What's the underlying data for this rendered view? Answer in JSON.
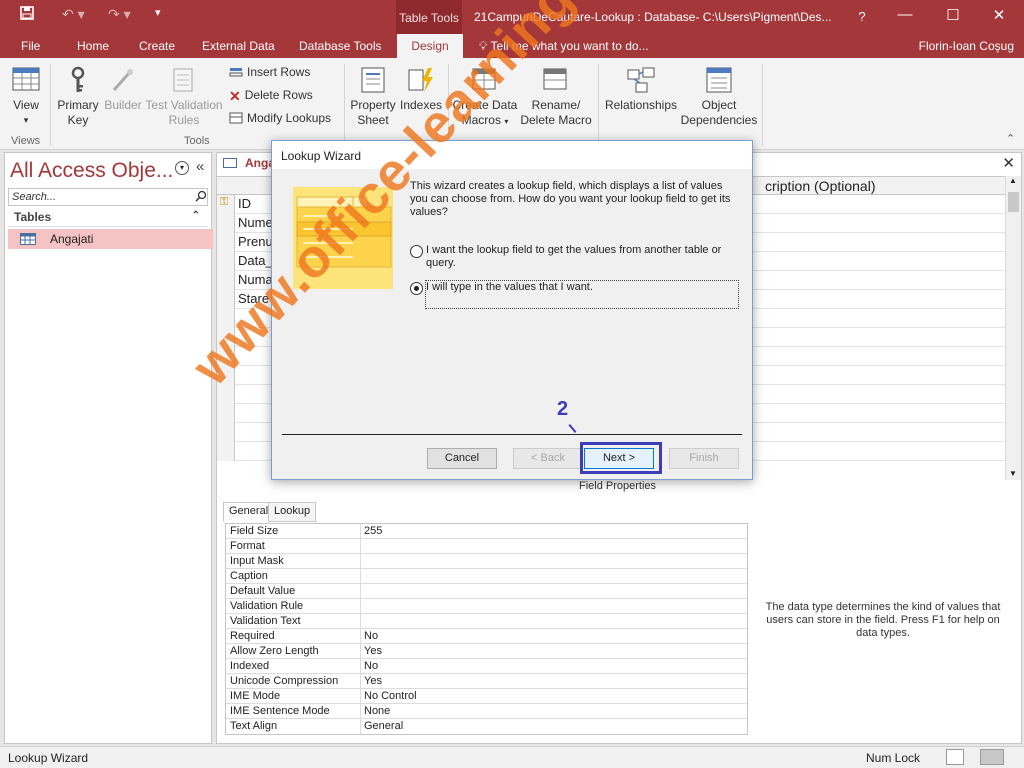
{
  "window": {
    "context_tab": "Table Tools",
    "title": "21CampuriDeCautare-Lookup : Database- C:\\Users\\Pigment\\Des...",
    "help_glyph": "?",
    "min_glyph": "—",
    "max_glyph": "☐",
    "close_glyph": "✕"
  },
  "tabs": [
    "File",
    "Home",
    "Create",
    "External Data",
    "Database Tools",
    "Design"
  ],
  "tell_me": "Tell me what you want to do...",
  "user": "Florin-Ioan Coşug",
  "ribbon": {
    "view": "View",
    "views_group": "Views",
    "primary_key": [
      "Primary",
      "Key"
    ],
    "builder": "Builder",
    "test_validation": [
      "Test Validation",
      "Rules"
    ],
    "insert_rows": "Insert Rows",
    "delete_rows": "Delete Rows",
    "modify_lookups": "Modify Lookups",
    "tools_group": "Tools",
    "property_sheet": [
      "Property",
      "Sheet"
    ],
    "indexes": "Indexes",
    "create_data_macros": [
      "Create Data",
      "Macros"
    ],
    "rename_delete_macro": [
      "Rename/",
      "Delete Macro"
    ],
    "relationships": "Relationships",
    "object_dependencies": [
      "Object",
      "Dependencies"
    ]
  },
  "nav": {
    "title": "All Access Obje...",
    "search_placeholder": "Search...",
    "section": "Tables",
    "item": "Angajati"
  },
  "doc": {
    "tab": "Angaj",
    "description_header": "cription (Optional)",
    "fields": [
      "ID",
      "Nume",
      "Prenu",
      "Data_",
      "Numa",
      "Stare"
    ],
    "field_properties_label": "Field Properties",
    "fp_tabs": [
      "General",
      "Lookup"
    ],
    "fp_rows": [
      {
        "k": "Field Size",
        "v": "255"
      },
      {
        "k": "Format",
        "v": ""
      },
      {
        "k": "Input Mask",
        "v": ""
      },
      {
        "k": "Caption",
        "v": ""
      },
      {
        "k": "Default Value",
        "v": ""
      },
      {
        "k": "Validation Rule",
        "v": ""
      },
      {
        "k": "Validation Text",
        "v": ""
      },
      {
        "k": "Required",
        "v": "No"
      },
      {
        "k": "Allow Zero Length",
        "v": "Yes"
      },
      {
        "k": "Indexed",
        "v": "No"
      },
      {
        "k": "Unicode Compression",
        "v": "Yes"
      },
      {
        "k": "IME Mode",
        "v": "No Control"
      },
      {
        "k": "IME Sentence Mode",
        "v": "None"
      },
      {
        "k": "Text Align",
        "v": "General"
      }
    ],
    "help_text": "The data type determines the kind of values that users can store in the field. Press F1 for help on data types."
  },
  "dialog": {
    "title": "Lookup Wizard",
    "intro": "This wizard creates a lookup field, which displays a list of values you can choose from.  How do you want your lookup field to get its values?",
    "option1": "I want the lookup field to get the values from another table or query.",
    "option2": "I will type in the values that I want.",
    "selected_option": 2,
    "cancel": "Cancel",
    "back": "< Back",
    "next": "Next >",
    "finish": "Finish"
  },
  "annotation": {
    "step": "2",
    "color": "#3d3db5"
  },
  "watermark": "www.office-learning.ro",
  "status": {
    "text": "Lookup Wizard",
    "num_lock": "Num Lock"
  },
  "colors": {
    "accent": "#a4373a",
    "watermark": "#ef761e"
  }
}
